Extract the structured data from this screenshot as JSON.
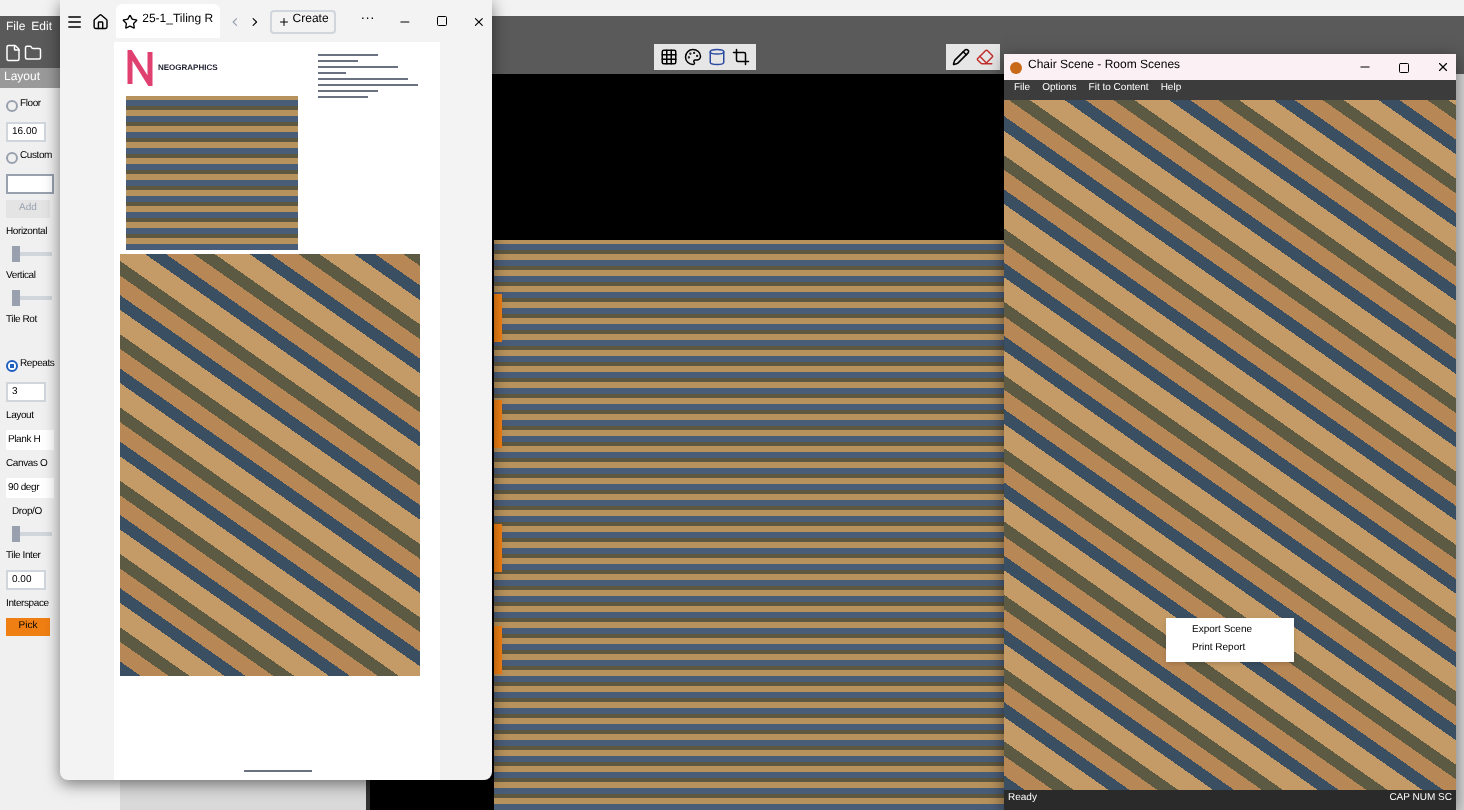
{
  "app": {
    "menu": [
      "File",
      "Edit"
    ],
    "panel_header": "Layout",
    "controls": [
      {
        "kind": "radio",
        "label": "Floor",
        "selected": false
      },
      {
        "kind": "field",
        "value": "16.00"
      },
      {
        "kind": "radio",
        "label": "Custom",
        "selected": false
      },
      {
        "kind": "blank"
      },
      {
        "kind": "button",
        "label": "Add",
        "disabled": true
      },
      {
        "kind": "label",
        "label": "Horizontal"
      },
      {
        "kind": "slider",
        "level": 0
      },
      {
        "kind": "label",
        "label": "Vertical"
      },
      {
        "kind": "slider",
        "level": 0
      },
      {
        "kind": "label",
        "label": "Tile Rot"
      },
      {
        "kind": "spacer"
      },
      {
        "kind": "radio",
        "label": "Repeats",
        "selected": true
      },
      {
        "kind": "field",
        "value": "3"
      },
      {
        "kind": "label",
        "label": "Layout"
      },
      {
        "kind": "select",
        "value": "Plank H"
      },
      {
        "kind": "label",
        "label": "Canvas O"
      },
      {
        "kind": "select",
        "value": "90 degr"
      },
      {
        "kind": "sublabel",
        "label": "Drop/O"
      },
      {
        "kind": "slider",
        "level": 0
      },
      {
        "kind": "label",
        "label": "Tile Inter"
      },
      {
        "kind": "field",
        "value": "0.00"
      },
      {
        "kind": "label",
        "label": "Interspace"
      },
      {
        "kind": "button",
        "label": "Pick",
        "disabled": false
      }
    ]
  },
  "pdf_viewer": {
    "tab_title": "25-1_Tiling R",
    "create_button": "Create",
    "more": "···",
    "logo_text": "NEOGRAPHICS"
  },
  "scene_window": {
    "title": "Chair Scene - Room Scenes",
    "menu": [
      "File",
      "Options",
      "Fit to Content",
      "Help"
    ],
    "context_menu": [
      "Export Scene",
      "Print Report"
    ],
    "status": "Ready",
    "indicators": "CAP NUM SC"
  }
}
